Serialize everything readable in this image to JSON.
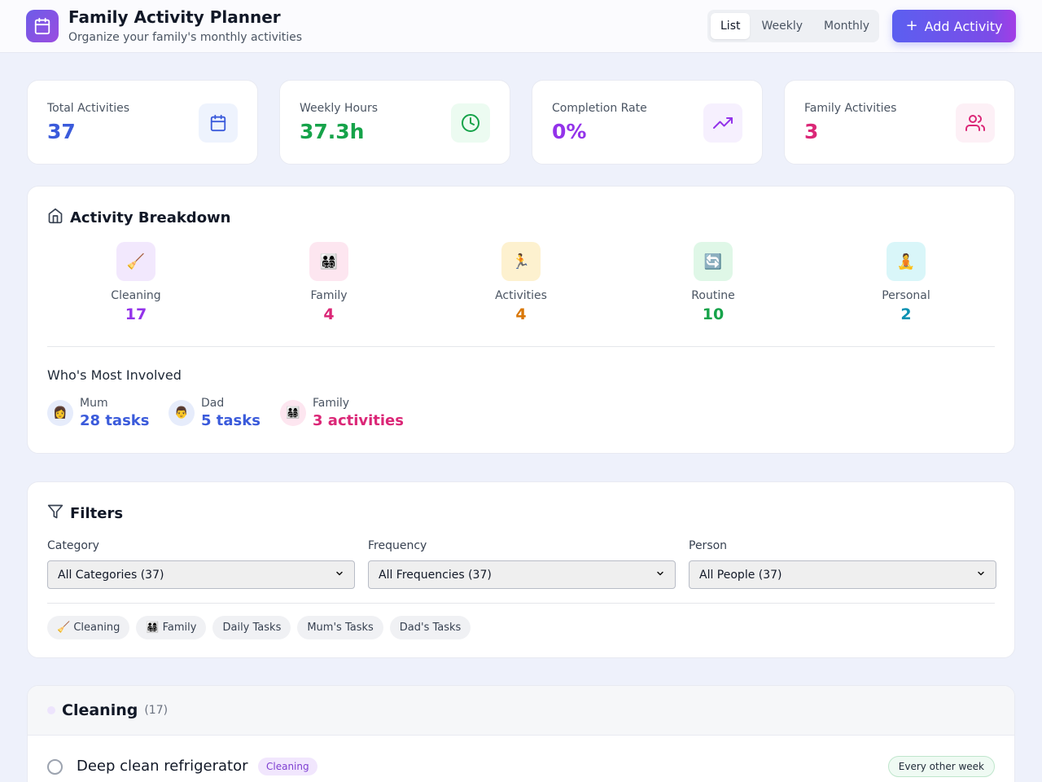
{
  "header": {
    "title": "Family Activity Planner",
    "subtitle": "Organize your family's monthly activities",
    "views": [
      "List",
      "Weekly",
      "Monthly"
    ],
    "active_view": "List",
    "add_label": "Add Activity"
  },
  "stats": [
    {
      "label": "Total Activities",
      "value": "37",
      "icon": "calendar-icon",
      "color": "#3b5bdb"
    },
    {
      "label": "Weekly Hours",
      "value": "37.3h",
      "icon": "clock-icon",
      "color": "#16a34a"
    },
    {
      "label": "Completion Rate",
      "value": "0%",
      "icon": "trending-up-icon",
      "color": "#9333ea"
    },
    {
      "label": "Family Activities",
      "value": "3",
      "icon": "users-icon",
      "color": "#db2777"
    }
  ],
  "breakdown": {
    "title": "Activity Breakdown",
    "categories": [
      {
        "name": "Cleaning",
        "count": "17",
        "emoji": "🧹",
        "color": "#9333ea"
      },
      {
        "name": "Family",
        "count": "4",
        "emoji": "👨‍👩‍👧‍👦",
        "color": "#db2777"
      },
      {
        "name": "Activities",
        "count": "4",
        "emoji": "🏃",
        "color": "#d97706"
      },
      {
        "name": "Routine",
        "count": "10",
        "emoji": "🔄",
        "color": "#16a34a"
      },
      {
        "name": "Personal",
        "count": "2",
        "emoji": "🧘",
        "color": "#0891b2"
      }
    ],
    "involved_title": "Who's Most Involved",
    "people": [
      {
        "name": "Mum",
        "count": "28 tasks",
        "emoji": "👩",
        "color": "#3b5bdb"
      },
      {
        "name": "Dad",
        "count": "5 tasks",
        "emoji": "👨",
        "color": "#3b5bdb"
      },
      {
        "name": "Family",
        "count": "3 activities",
        "emoji": "👨‍👩‍👧‍👦",
        "color": "#db2777"
      }
    ]
  },
  "filters": {
    "title": "Filters",
    "groups": [
      {
        "label": "Category",
        "value": "All Categories (37)"
      },
      {
        "label": "Frequency",
        "value": "All Frequencies (37)"
      },
      {
        "label": "Person",
        "value": "All People (37)"
      }
    ],
    "chips": [
      "🧹 Cleaning",
      "👨‍👩‍👧‍👦 Family",
      "Daily Tasks",
      "Mum's Tasks",
      "Dad's Tasks"
    ]
  },
  "section": {
    "title": "Cleaning",
    "count": "(17)",
    "tasks": [
      {
        "name": "Deep clean refrigerator",
        "category": "Cleaning",
        "frequency": "Every other week"
      }
    ]
  }
}
